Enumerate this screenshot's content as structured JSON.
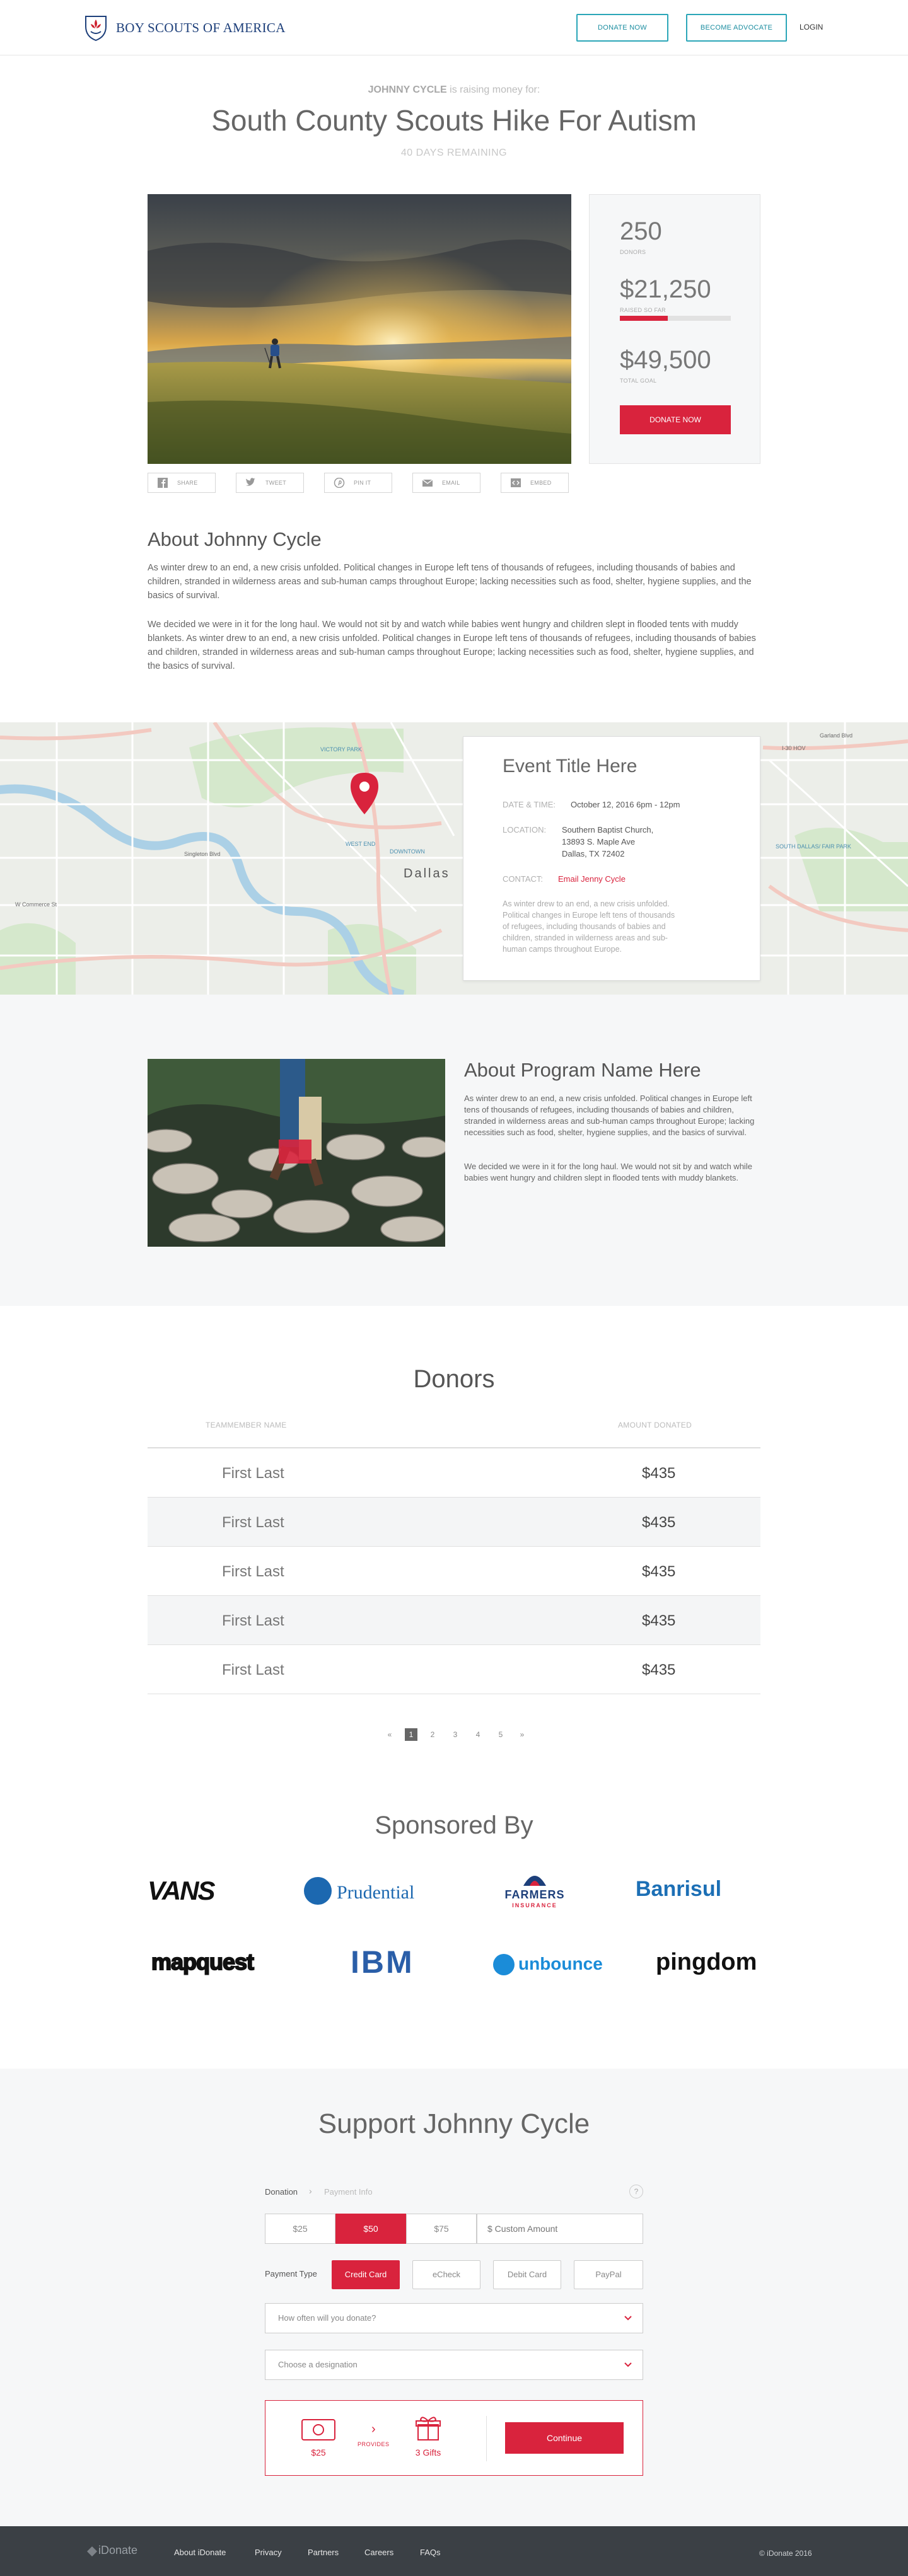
{
  "header": {
    "brand": "BOY SCOUTS OF AMERICA",
    "donate_now": "DONATE NOW",
    "become_advocate": "BECOME ADVOCATE",
    "login": "LOGIN"
  },
  "hero": {
    "fundraiser_name": "JOHNNY CYCLE",
    "raising_suffix": " is raising money for:",
    "title": "South County Scouts Hike For  Autism",
    "days_remaining": "40 DAYS REMAINING"
  },
  "stats": {
    "donors_value": "250",
    "donors_label": "DONORS",
    "raised_value": "$21,250",
    "raised_label": "RAISED SO FAR",
    "progress_fraction": 0.43,
    "goal_value": "$49,500",
    "goal_label": "TOTAL GOAL",
    "donate_button": "DONATE NOW"
  },
  "share_buttons": [
    {
      "label": "SHARE",
      "icon": "facebook-icon"
    },
    {
      "label": "TWEET",
      "icon": "twitter-icon"
    },
    {
      "label": "PIN IT",
      "icon": "pinterest-icon"
    },
    {
      "label": "EMAIL",
      "icon": "email-icon"
    },
    {
      "label": "EMBED",
      "icon": "embed-icon"
    }
  ],
  "about": {
    "heading": "About Johnny Cycle",
    "p1": "As winter drew to an end, a new crisis unfolded. Political changes in Europe left tens of thousands of refugees, including thousands of babies and children, stranded in wilderness areas and sub-human camps throughout Europe; lacking necessities such as food, shelter, hygiene supplies, and the basics of survival.",
    "p2": "We decided we were in it for the long haul. We would not sit by and watch while babies went hungry and children slept in flooded tents with muddy blankets. As winter drew to an end, a new crisis unfolded. Political changes in Europe left tens of thousands of refugees, including thousands of babies and children, stranded in wilderness areas and sub-human camps throughout Europe; lacking necessities such as food, shelter, hygiene supplies, and the basics of survival."
  },
  "map": {
    "labels": {
      "victory_park": "VICTORY PARK",
      "west_end": "WEST END",
      "downtown": "DOWNTOWN",
      "dallas": "Dallas",
      "south_dallas": "SOUTH DALLAS/ FAIR PARK",
      "singleton": "Singleton Blvd",
      "commerce": "W Commerce St",
      "garland": "Garland Blvd",
      "i30": "I-30 HOV"
    }
  },
  "event": {
    "title": "Event Title Here",
    "date_label": "DATE & TIME:",
    "date_value": "October 12, 2016 6pm - 12pm",
    "location_label": "LOCATION:",
    "location_line1": "Southern Baptist Church,",
    "location_line2": "13893 S. Maple Ave",
    "location_line3": "Dallas, TX 72402",
    "contact_label": "CONTACT:",
    "contact_value": "Email Jenny Cycle",
    "description": "As winter drew to an end, a new crisis unfolded. Political changes in Europe left tens of thousands of refugees, including thousands of babies and children, stranded in wilderness areas and sub-human camps throughout Europe."
  },
  "program": {
    "heading": "About Program Name Here",
    "p1": "As winter drew to an end, a new crisis unfolded. Political changes in Europe left tens of thousands of refugees, including thousands of babies and children, stranded in wilderness areas and sub-human camps throughout Europe; lacking necessities such as food, shelter, hygiene supplies, and the basics of survival.",
    "p2": "We decided we were in it for the long haul. We would not sit by and watch while babies went hungry and children slept in flooded tents with muddy blankets."
  },
  "donors": {
    "heading": "Donors",
    "col_name": "TEAMMEMBER NAME",
    "col_amount": "AMOUNT DONATED",
    "rows": [
      {
        "name": "First Last",
        "amount": "$435"
      },
      {
        "name": "First Last",
        "amount": "$435"
      },
      {
        "name": "First Last",
        "amount": "$435"
      },
      {
        "name": "First Last",
        "amount": "$435"
      },
      {
        "name": "First Last",
        "amount": "$435"
      }
    ],
    "pagination": {
      "prev": "«",
      "pages": [
        "1",
        "2",
        "3",
        "4",
        "5"
      ],
      "next": "»",
      "current": "1"
    }
  },
  "sponsors": {
    "heading": "Sponsored By",
    "logos": [
      "VANS",
      "Prudential",
      "FARMERS",
      "INSURANCE",
      "Banrisul",
      "mapquest",
      "IBM",
      "unbounce",
      "pingdom"
    ]
  },
  "support": {
    "heading": "Support Johnny Cycle",
    "step1": "Donation",
    "step2": "Payment Info",
    "help": "?",
    "amounts": [
      "$25",
      "$50",
      "$75"
    ],
    "selected_amount": "$50",
    "custom_placeholder": "$ Custom Amount",
    "payment_type_label": "Payment Type",
    "payment_types": [
      "Credit Card",
      "eCheck",
      "Debit Card",
      "PayPal"
    ],
    "selected_payment": "Credit Card",
    "frequency_placeholder": "How often will you donate?",
    "designation_placeholder": "Choose a designation",
    "summary_amount": "$25",
    "provides": "PROVIDES",
    "gifts": "3 Gifts",
    "continue": "Continue"
  },
  "footer": {
    "brand": "iDonate",
    "links": [
      "About iDonate",
      "Privacy",
      "Partners",
      "Careers",
      "FAQs"
    ],
    "copyright": "© iDonate 2016"
  },
  "colors": {
    "accent": "#d9233d",
    "teal": "#2ba6b8",
    "navy": "#1d3f7a",
    "footer": "#3b4045"
  }
}
